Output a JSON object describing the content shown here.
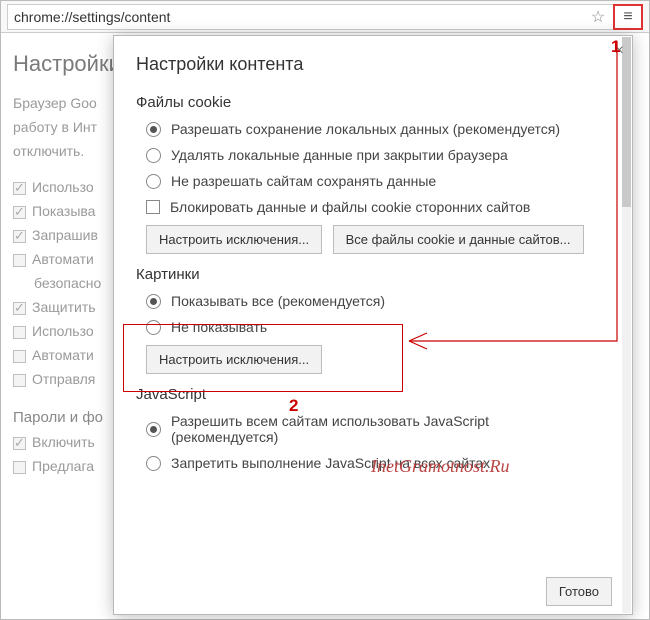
{
  "omnibox": {
    "url": "chrome://settings/content"
  },
  "bg": {
    "title": "Настройки",
    "text_lines": [
      "Браузер Goo",
      "работу в Инт",
      "отключить."
    ],
    "checks": [
      {
        "checked": true,
        "label": "Использо"
      },
      {
        "checked": true,
        "label": "Показыва"
      },
      {
        "checked": true,
        "label": "Запрашив"
      },
      {
        "checked": false,
        "label": "Автомати"
      },
      {
        "checked": false,
        "label": "безопасно",
        "nolabelcb": true
      },
      {
        "checked": true,
        "label": "Защитить"
      },
      {
        "checked": false,
        "label": "Использо"
      },
      {
        "checked": false,
        "label": "Автомати"
      },
      {
        "checked": false,
        "label": "Отправля"
      }
    ],
    "section2": "Пароли и фо",
    "checks2": [
      {
        "checked": true,
        "label": "Включить"
      },
      {
        "checked": false,
        "label": "Предлага"
      }
    ]
  },
  "dialog": {
    "title": "Настройки контента",
    "cookies": {
      "heading": "Файлы cookie",
      "opts": [
        "Разрешать сохранение локальных данных (рекомендуется)",
        "Удалять локальные данные при закрытии браузера",
        "Не разрешать сайтам сохранять данные"
      ],
      "block3rd": "Блокировать данные и файлы cookie сторонних сайтов",
      "btn_exc": "Настроить исключения...",
      "btn_all": "Все файлы cookie и данные сайтов..."
    },
    "images": {
      "heading": "Картинки",
      "opts": [
        "Показывать все (рекомендуется)",
        "Не показывать"
      ],
      "btn_exc": "Настроить исключения..."
    },
    "js": {
      "heading": "JavaScript",
      "opts": [
        "Разрешить всем сайтам использовать JavaScript (рекомендуется)",
        "Запретить выполнение JavaScript на всех сайтах"
      ]
    },
    "done": "Готово"
  },
  "annot": {
    "m1": "1",
    "m2": "2",
    "watermark": "InetGramotnost.Ru"
  }
}
